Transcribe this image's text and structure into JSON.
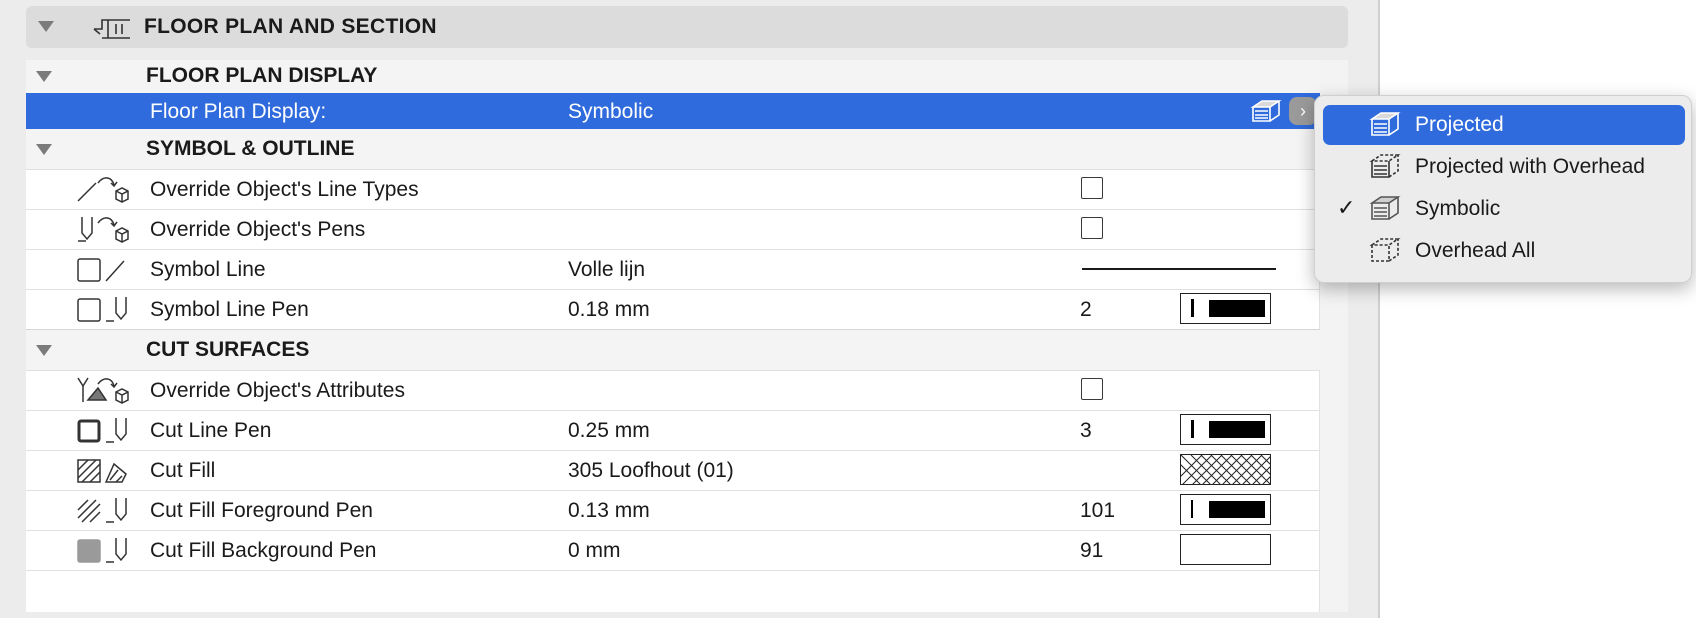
{
  "header": {
    "title": "FLOOR PLAN AND SECTION",
    "icon": "floor-plan-section-icon"
  },
  "sections": {
    "floor_plan_display": {
      "title": "FLOOR PLAN DISPLAY"
    },
    "symbol_outline": {
      "title": "SYMBOL & OUTLINE"
    },
    "cut_surfaces": {
      "title": "CUT SURFACES"
    }
  },
  "rows": {
    "fpd": {
      "label": "Floor Plan Display:",
      "value": "Symbolic"
    },
    "override_line_types": {
      "label": "Override Object's Line Types",
      "checked": false
    },
    "override_pens": {
      "label": "Override Object's Pens",
      "checked": false
    },
    "symbol_line": {
      "label": "Symbol Line",
      "value": "Volle lijn"
    },
    "symbol_line_pen": {
      "label": "Symbol Line Pen",
      "value": "0.18 mm",
      "pen": "2"
    },
    "override_attributes": {
      "label": "Override Object's Attributes",
      "checked": false
    },
    "cut_line_pen": {
      "label": "Cut Line Pen",
      "value": "0.25 mm",
      "pen": "3"
    },
    "cut_fill": {
      "label": "Cut Fill",
      "value": "305 Loofhout (01)"
    },
    "cut_fill_fg_pen": {
      "label": "Cut Fill Foreground Pen",
      "value": "0.13 mm",
      "pen": "101"
    },
    "cut_fill_bg_pen": {
      "label": "Cut Fill Background Pen",
      "value": "0 mm",
      "pen": "91"
    }
  },
  "dropdown": {
    "items": [
      {
        "label": "Projected",
        "highlighted": true
      },
      {
        "label": "Projected with Overhead"
      },
      {
        "label": "Symbolic",
        "checked": true
      },
      {
        "label": "Overhead All"
      }
    ],
    "check_glyph": "✓"
  },
  "colors": {
    "selection": "#2f6bdc",
    "menu_bg": "#ececec"
  }
}
